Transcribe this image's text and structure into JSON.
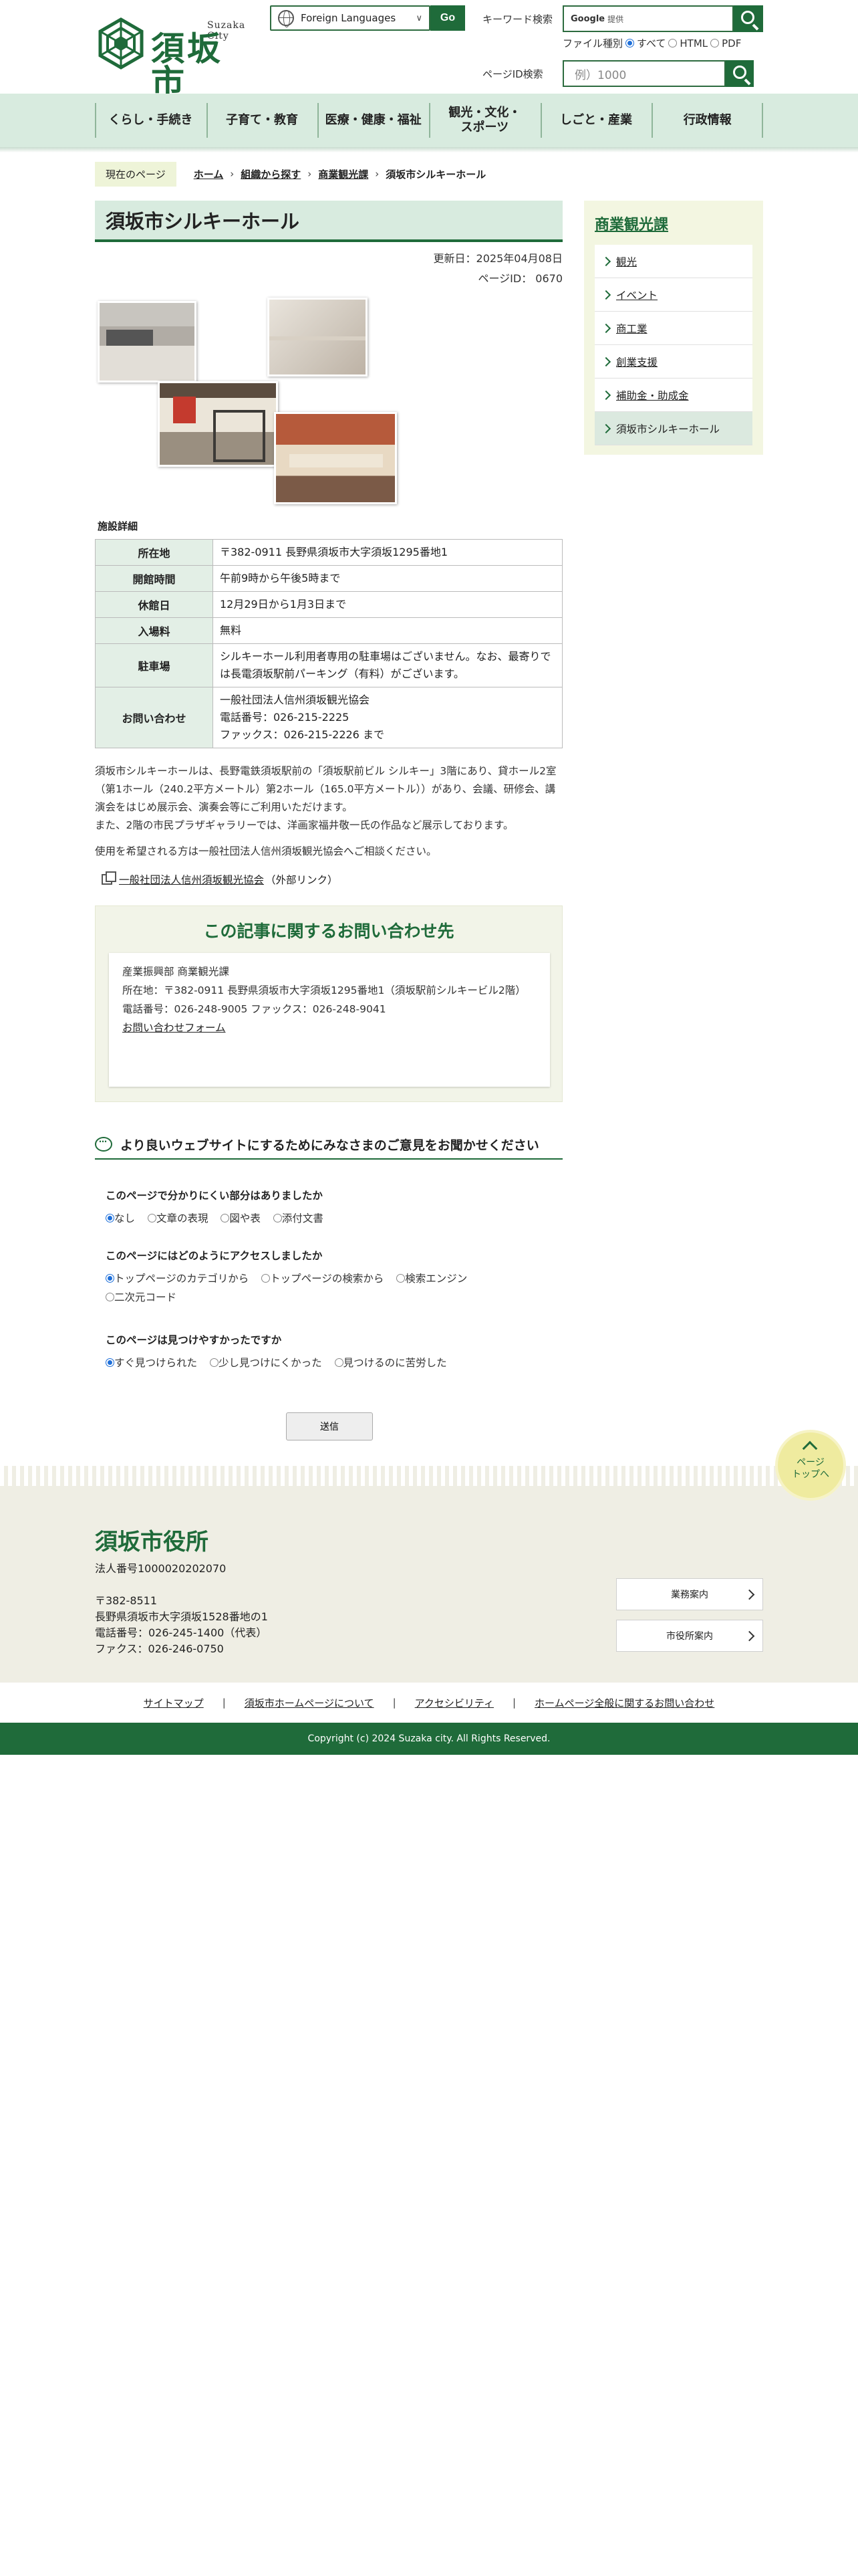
{
  "header": {
    "city_en": "Suzaka City",
    "city_jp": "須坂市",
    "lang_label": "Foreign Languages",
    "go_label": "Go",
    "keyword_label": "キーワード検索",
    "google_mark": "Google",
    "keyword_placeholder": "提供",
    "filetype_label": "ファイル種別",
    "filetype_options": [
      "すべて",
      "HTML",
      "PDF"
    ],
    "pageid_label": "ページID検索",
    "pageid_placeholder": "例）1000"
  },
  "gnav": [
    "くらし・手続き",
    "子育て・教育",
    "医療・健康・福祉",
    "観光・文化・\nスポーツ",
    "しごと・産業",
    "行政情報"
  ],
  "breadcrumb": {
    "here": "現在のページ",
    "items": [
      "ホーム",
      "組織から探す",
      "商業観光課"
    ],
    "current": "須坂市シルキーホール"
  },
  "page": {
    "title": "須坂市シルキーホール",
    "updated": "更新日：2025年04月08日",
    "page_id": "ページID： 0670",
    "section_label": "施設詳細",
    "facility": [
      {
        "label": "所在地",
        "value": "〒382-0911 長野県須坂市大字須坂1295番地1"
      },
      {
        "label": "開館時間",
        "value": "午前9時から午後5時まで"
      },
      {
        "label": "休館日",
        "value": "12月29日から1月3日まで"
      },
      {
        "label": "入場料",
        "value": "無料"
      },
      {
        "label": "駐車場",
        "value": "シルキーホール利用者専用の駐車場はございません。なお、最寄りでは長電須坂駅前パーキング（有料）がございます。"
      },
      {
        "label": "お問い合わせ",
        "value": "一般社団法人信州須坂観光協会\n電話番号：026-215-2225\nファックス：026-215-2226 まで"
      }
    ],
    "desc1": "須坂市シルキーホールは、長野電鉄須坂駅前の「須坂駅前ビル シルキー」3階にあり、貸ホール2室（第1ホール（240.2平方メートル）第2ホール（165.0平方メートル））があり、会議、研修会、講演会をはじめ展示会、演奏会等にご利用いただけます。",
    "desc2": "また、2階の市民プラザギャラリーでは、洋画家福井敬一氏の作品など展示しております。",
    "desc3": "使用を希望される方は一般社団法人信州須坂観光協会へご相談ください。",
    "ext_link": "一般社団法人信州須坂観光協会",
    "ext_note": "（外部リンク）"
  },
  "contact": {
    "title": "この記事に関するお問い合わせ先",
    "dept": "産業振興部 商業観光課",
    "address": "所在地：〒382-0911 長野県須坂市大字須坂1295番地1（須坂駅前シルキービル2階）",
    "phone": "電話番号：026-248-9005 ファックス：026-248-9041",
    "form_link": "お問い合わせフォーム"
  },
  "survey": {
    "title": "より良いウェブサイトにするためにみなさまのご意見をお聞かせください",
    "questions": [
      {
        "q": "このページで分かりにくい部分はありましたか",
        "options": [
          "なし",
          "文章の表現",
          "図や表",
          "添付文書"
        ]
      },
      {
        "q": "このページにはどのようにアクセスしましたか",
        "options": [
          "トップページのカテゴリから",
          "トップページの検索から",
          "検索エンジン",
          "二次元コード"
        ]
      },
      {
        "q": "このページは見つけやすかったですか",
        "options": [
          "すぐ見つけられた",
          "少し見つけにくかった",
          "見つけるのに苦労した"
        ]
      }
    ],
    "submit": "送信"
  },
  "side": {
    "title": "商業観光課",
    "items": [
      "観光",
      "イベント",
      "商工業",
      "創業支援",
      "補助金・助成金",
      "須坂市シルキーホール"
    ]
  },
  "pagetop": "ページ\nトップへ",
  "footer": {
    "name": "須坂市役所",
    "corp_no": "法人番号1000020202070",
    "zip": "〒382-8511",
    "address": "長野県須坂市大字須坂1528番地の1",
    "phone": "電話番号：026-245-1400（代表）",
    "fax": "ファクス：026-246-0750",
    "btn1": "業務案内",
    "btn2": "市役所案内",
    "links": [
      "サイトマップ",
      "須坂市ホームページについて",
      "アクセシビリティ",
      "ホームページ全般に関するお問い合わせ"
    ],
    "copyright": "Copyright (c) 2024 Suzaka city. All Rights Reserved."
  },
  "colors": {
    "brand_green": "#1f6b3a",
    "nav_bg": "#d8ebdf",
    "side_bg": "#f3f6e1"
  }
}
